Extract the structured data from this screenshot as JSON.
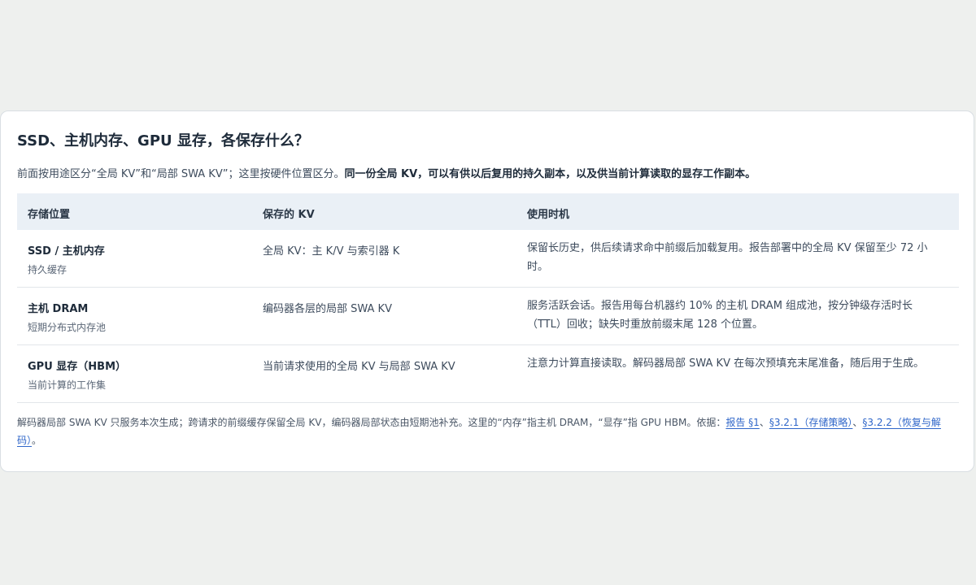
{
  "card": {
    "title": "SSD、主机内存、GPU 显存，各保存什么？",
    "intro_plain": "前面按用途区分“全局 KV”和“局部 SWA KV”；这里按硬件位置区分。",
    "intro_bold": "同一份全局 KV，可以有供以后复用的持久副本，以及供当前计算读取的显存工作副本。"
  },
  "table": {
    "headers": [
      "存储位置",
      "保存的 KV",
      "使用时机"
    ],
    "rows": [
      {
        "location": "SSD / 主机内存",
        "location_sub": "持久缓存",
        "kv": "全局 KV：主 K/V 与索引器 K",
        "when": "保留长历史，供后续请求命中前缀后加载复用。报告部署中的全局 KV 保留至少 72 小时。"
      },
      {
        "location": "主机 DRAM",
        "location_sub": "短期分布式内存池",
        "kv": "编码器各层的局部 SWA KV",
        "when": "服务活跃会话。报告用每台机器约 10% 的主机 DRAM 组成池，按分钟级存活时长（TTL）回收；缺失时重放前缀末尾 128 个位置。"
      },
      {
        "location": "GPU 显存（HBM）",
        "location_sub": "当前计算的工作集",
        "kv": "当前请求使用的全局 KV 与局部 SWA KV",
        "when": "注意力计算直接读取。解码器局部 SWA KV 在每次预填充末尾准备，随后用于生成。"
      }
    ]
  },
  "footnote": {
    "text": "解码器局部 SWA KV 只服务本次生成；跨请求的前缀缓存保留全局 KV，编码器局部状态由短期池补充。这里的“内存”指主机 DRAM，“显存”指 GPU HBM。依据：",
    "link1": "报告 §1",
    "sep1": "、",
    "link2": "§3.2.1（存储策略）",
    "sep2": "、",
    "link3": "§3.2.2（恢复与解码）",
    "end": "。"
  }
}
